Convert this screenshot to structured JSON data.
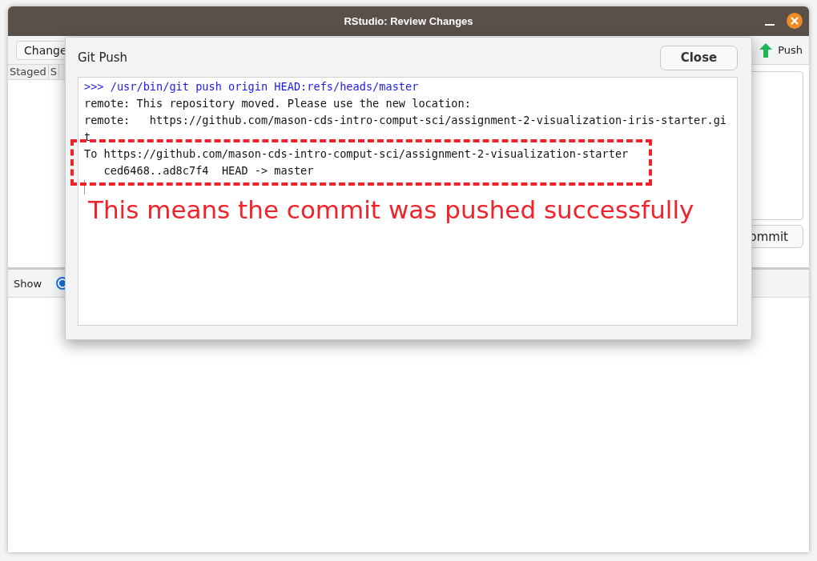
{
  "window": {
    "title": "RStudio: Review Changes"
  },
  "toolbar": {
    "changes_button": "Change",
    "push_button": "Push"
  },
  "file_table": {
    "columns": [
      "Staged",
      "S"
    ]
  },
  "commit_button": "ommit",
  "show_bar": {
    "label": "Show",
    "radio_selected": true
  },
  "dialog": {
    "title": "Git Push",
    "close_button": "Close",
    "console_lines": [
      {
        "kind": "command",
        "text": ">>> /usr/bin/git push origin HEAD:refs/heads/master"
      },
      {
        "kind": "output",
        "text": "remote: This repository moved. Please use the new location:"
      },
      {
        "kind": "output",
        "text": "remote:   https://github.com/mason-cds-intro-comput-sci/assignment-2-visualization-iris-starter.git"
      },
      {
        "kind": "output",
        "text": "To https://github.com/mason-cds-intro-comput-sci/assignment-2-visualization-starter"
      },
      {
        "kind": "output",
        "text": "   ced6468..ad8c7f4  HEAD -> master"
      }
    ]
  },
  "annotation": {
    "text": "This means the commit was pushed successfully"
  }
}
